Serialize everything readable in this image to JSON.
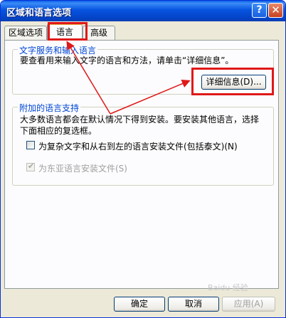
{
  "window": {
    "title": "区域和语言选项",
    "help_glyph": "?",
    "close_glyph": "✕"
  },
  "tabs": [
    {
      "label": "区域选项",
      "active": false
    },
    {
      "label": "语言",
      "active": true
    },
    {
      "label": "高级",
      "active": false
    }
  ],
  "text_services": {
    "group_label": "文字服务和输入语言",
    "description": "要查看用来输入文字的语言和方法，请单击“详细信息”。",
    "details_button": "详细信息(D)..."
  },
  "supplemental": {
    "group_label": "附加的语言支持",
    "description_line1": "大多数语言都会在默认情况下得到安装。要安装其他语言，选择",
    "description_line2": "下面相应的复选框。",
    "checkbox_complex": {
      "label": "为复杂文字和从右到左的语言安装文件(包括泰文)(N)",
      "checked": false,
      "enabled": true
    },
    "checkbox_east_asian": {
      "label": "为东亚语言安装文件(S)",
      "checked": true,
      "enabled": false
    }
  },
  "footer": {
    "ok": "确定",
    "cancel": "取消",
    "apply": "应用(A)"
  },
  "watermark": "Baidu 经验",
  "colors": {
    "titlebar": "#0653e0",
    "group_label": "#0046d5",
    "annotation_red": "#e01818",
    "dialog_face": "#ece9d8"
  }
}
